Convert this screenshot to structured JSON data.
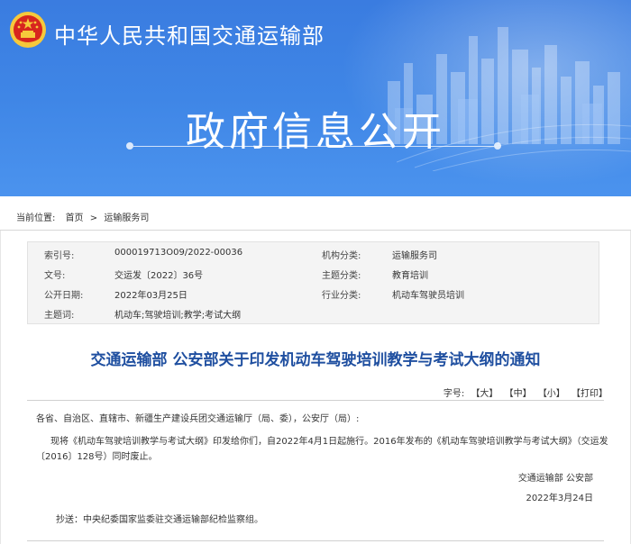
{
  "header": {
    "ministry_name": "中华人民共和国交通运输部",
    "section_title": "政府信息公开"
  },
  "breadcrumb": {
    "label": "当前位置:",
    "items": [
      "首页",
      "运输服务司"
    ],
    "separator": ">"
  },
  "meta": {
    "index_no_label": "索引号:",
    "index_no": "000019713O09/2022-00036",
    "agency_label": "机构分类:",
    "agency": "运输服务司",
    "doc_no_label": "文号:",
    "doc_no": "交运发〔2022〕36号",
    "topic_label": "主题分类:",
    "topic": "教育培训",
    "date_label": "公开日期:",
    "date": "2022年03月25日",
    "industry_label": "行业分类:",
    "industry": "机动车驾驶员培训",
    "keywords_label": "主题词:",
    "keywords": "机动车;驾驶培训;教学;考试大纲"
  },
  "article": {
    "title": "交通运输部 公安部关于印发机动车驾驶培训教学与考试大纲的通知",
    "font_size_label": "字号:",
    "font_large": "【大】",
    "font_medium": "【中】",
    "font_small": "【小】",
    "print": "【打印】",
    "salutation": "各省、自治区、直辖市、新疆生产建设兵团交通运输厅（局、委），公安厅（局）:",
    "body_line1": "现将《机动车驾驶培训教学与考试大纲》印发给你们，自2022年4月1日起施行。2016年发布的《机动车驾驶培训教学与考试大纲》（交运发",
    "body_line2": "〔2016〕128号）同时废止。",
    "signature": "交通运输部 公安部",
    "sign_date": "2022年3月24日",
    "cc": "抄送：中央纪委国家监委驻交通运输部纪检监察组。"
  },
  "colors": {
    "banner_blue": "#3f86e6",
    "title_blue": "#1f4fa0",
    "emblem_red": "#d7261e",
    "emblem_gold": "#f6c93b"
  }
}
